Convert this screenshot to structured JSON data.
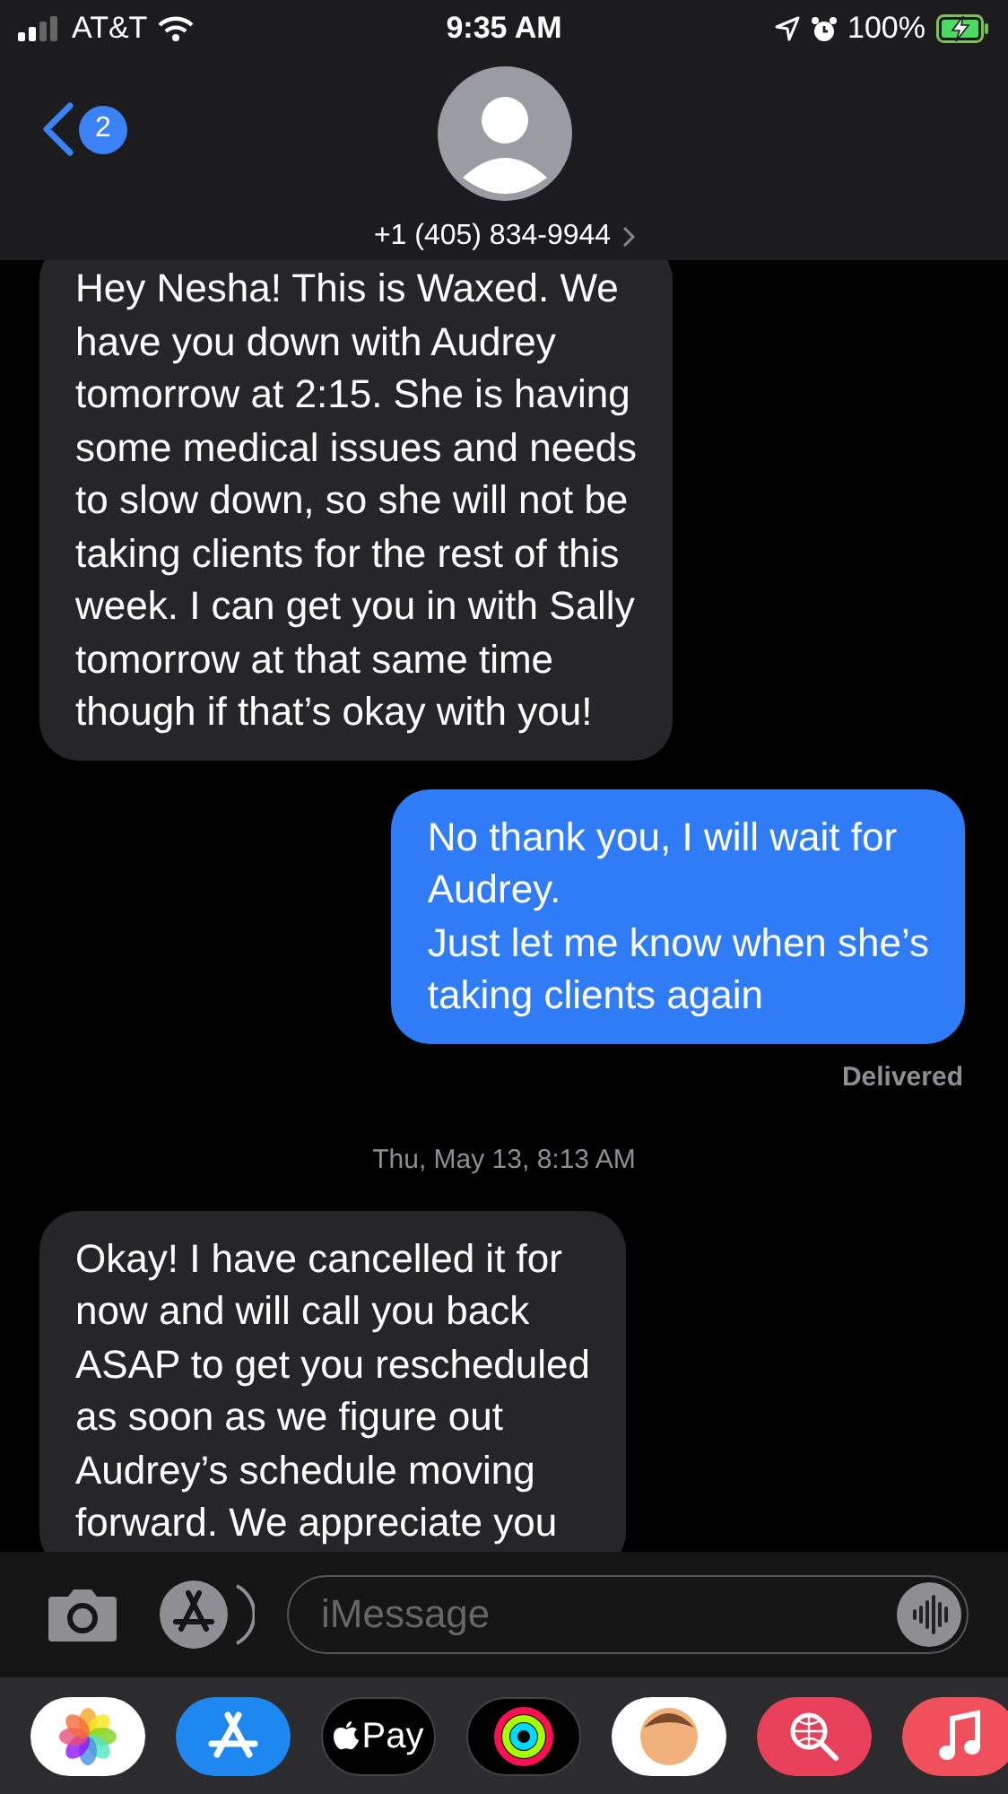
{
  "status_bar": {
    "carrier": "AT&T",
    "time": "9:35 AM",
    "battery": "100%",
    "charging": true
  },
  "header": {
    "back_badge": "2",
    "contact": "+1 (405) 834-9944"
  },
  "messages": [
    {
      "kind": "received",
      "text": "Hey Nesha! This is Waxed. We\nhave you down with Audrey\ntomorrow at 2:15. She is having\nsome medical issues and needs\nto slow down, so she will not be\ntaking clients for the rest of this\nweek. I can get you in with Sally\ntomorrow at that same time\nthough if that’s okay with you!"
    },
    {
      "kind": "sent",
      "text": "No thank you, I will wait for\nAudrey.\nJust let me know when she’s\ntaking clients again"
    },
    {
      "kind": "status",
      "text": "Delivered"
    },
    {
      "kind": "timestamp",
      "text": "Thu, May 13, 8:13 AM"
    },
    {
      "kind": "received",
      "text": "Okay! I have cancelled it for\nnow and will call you back\nASAP to get you rescheduled\nas soon as we figure out\nAudrey’s schedule moving\nforward. We appreciate you"
    }
  ],
  "composer": {
    "placeholder": "iMessage"
  },
  "app_drawer": [
    {
      "kind": "photos"
    },
    {
      "kind": "app-store"
    },
    {
      "kind": "pay",
      "label": "Pay"
    },
    {
      "kind": "activity"
    },
    {
      "kind": "memoji"
    },
    {
      "kind": "search"
    },
    {
      "kind": "music"
    }
  ]
}
